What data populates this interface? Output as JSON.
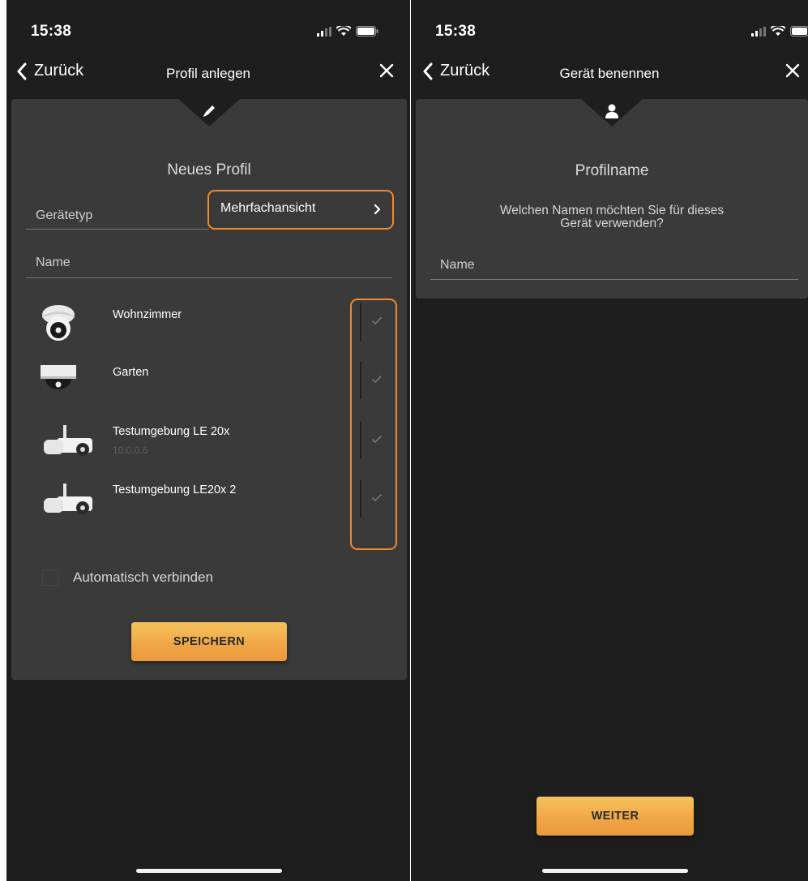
{
  "left": {
    "status": {
      "time": "15:38"
    },
    "nav": {
      "back_label": "Zurück",
      "title": "Profil anlegen"
    },
    "card": {
      "title": "Neues Profil",
      "device_type_label": "Gerätetyp",
      "device_type_value": "Mehrfachansicht",
      "name_placeholder": "Name",
      "devices": [
        {
          "name": "Wohnzimmer",
          "ip": "",
          "icon": "dome-camera-icon",
          "checked": true
        },
        {
          "name": "Garten",
          "ip": "",
          "icon": "ceiling-camera-icon",
          "checked": true
        },
        {
          "name": "Testumgebung LE 20x",
          "ip": "10.0.0.6",
          "icon": "bullet-camera-icon",
          "checked": true
        },
        {
          "name": "Testumgebung LE20x 2",
          "ip": "",
          "icon": "bullet-camera-icon",
          "checked": true
        }
      ],
      "auto_connect_label": "Automatisch verbinden",
      "save_label": "SPEICHERN"
    }
  },
  "right": {
    "status": {
      "time": "15:38"
    },
    "nav": {
      "back_label": "Zurück",
      "title": "Gerät benennen"
    },
    "card": {
      "title": "Profilname",
      "question": "Welchen Namen möchten Sie für dieses\nGerät verwenden?",
      "name_placeholder": "Name"
    },
    "next_label": "WEITER"
  },
  "colors": {
    "accent": "#f0a545",
    "highlight": "#f08a2c",
    "card": "#3a3a3a",
    "background": "#1e1e1e"
  }
}
